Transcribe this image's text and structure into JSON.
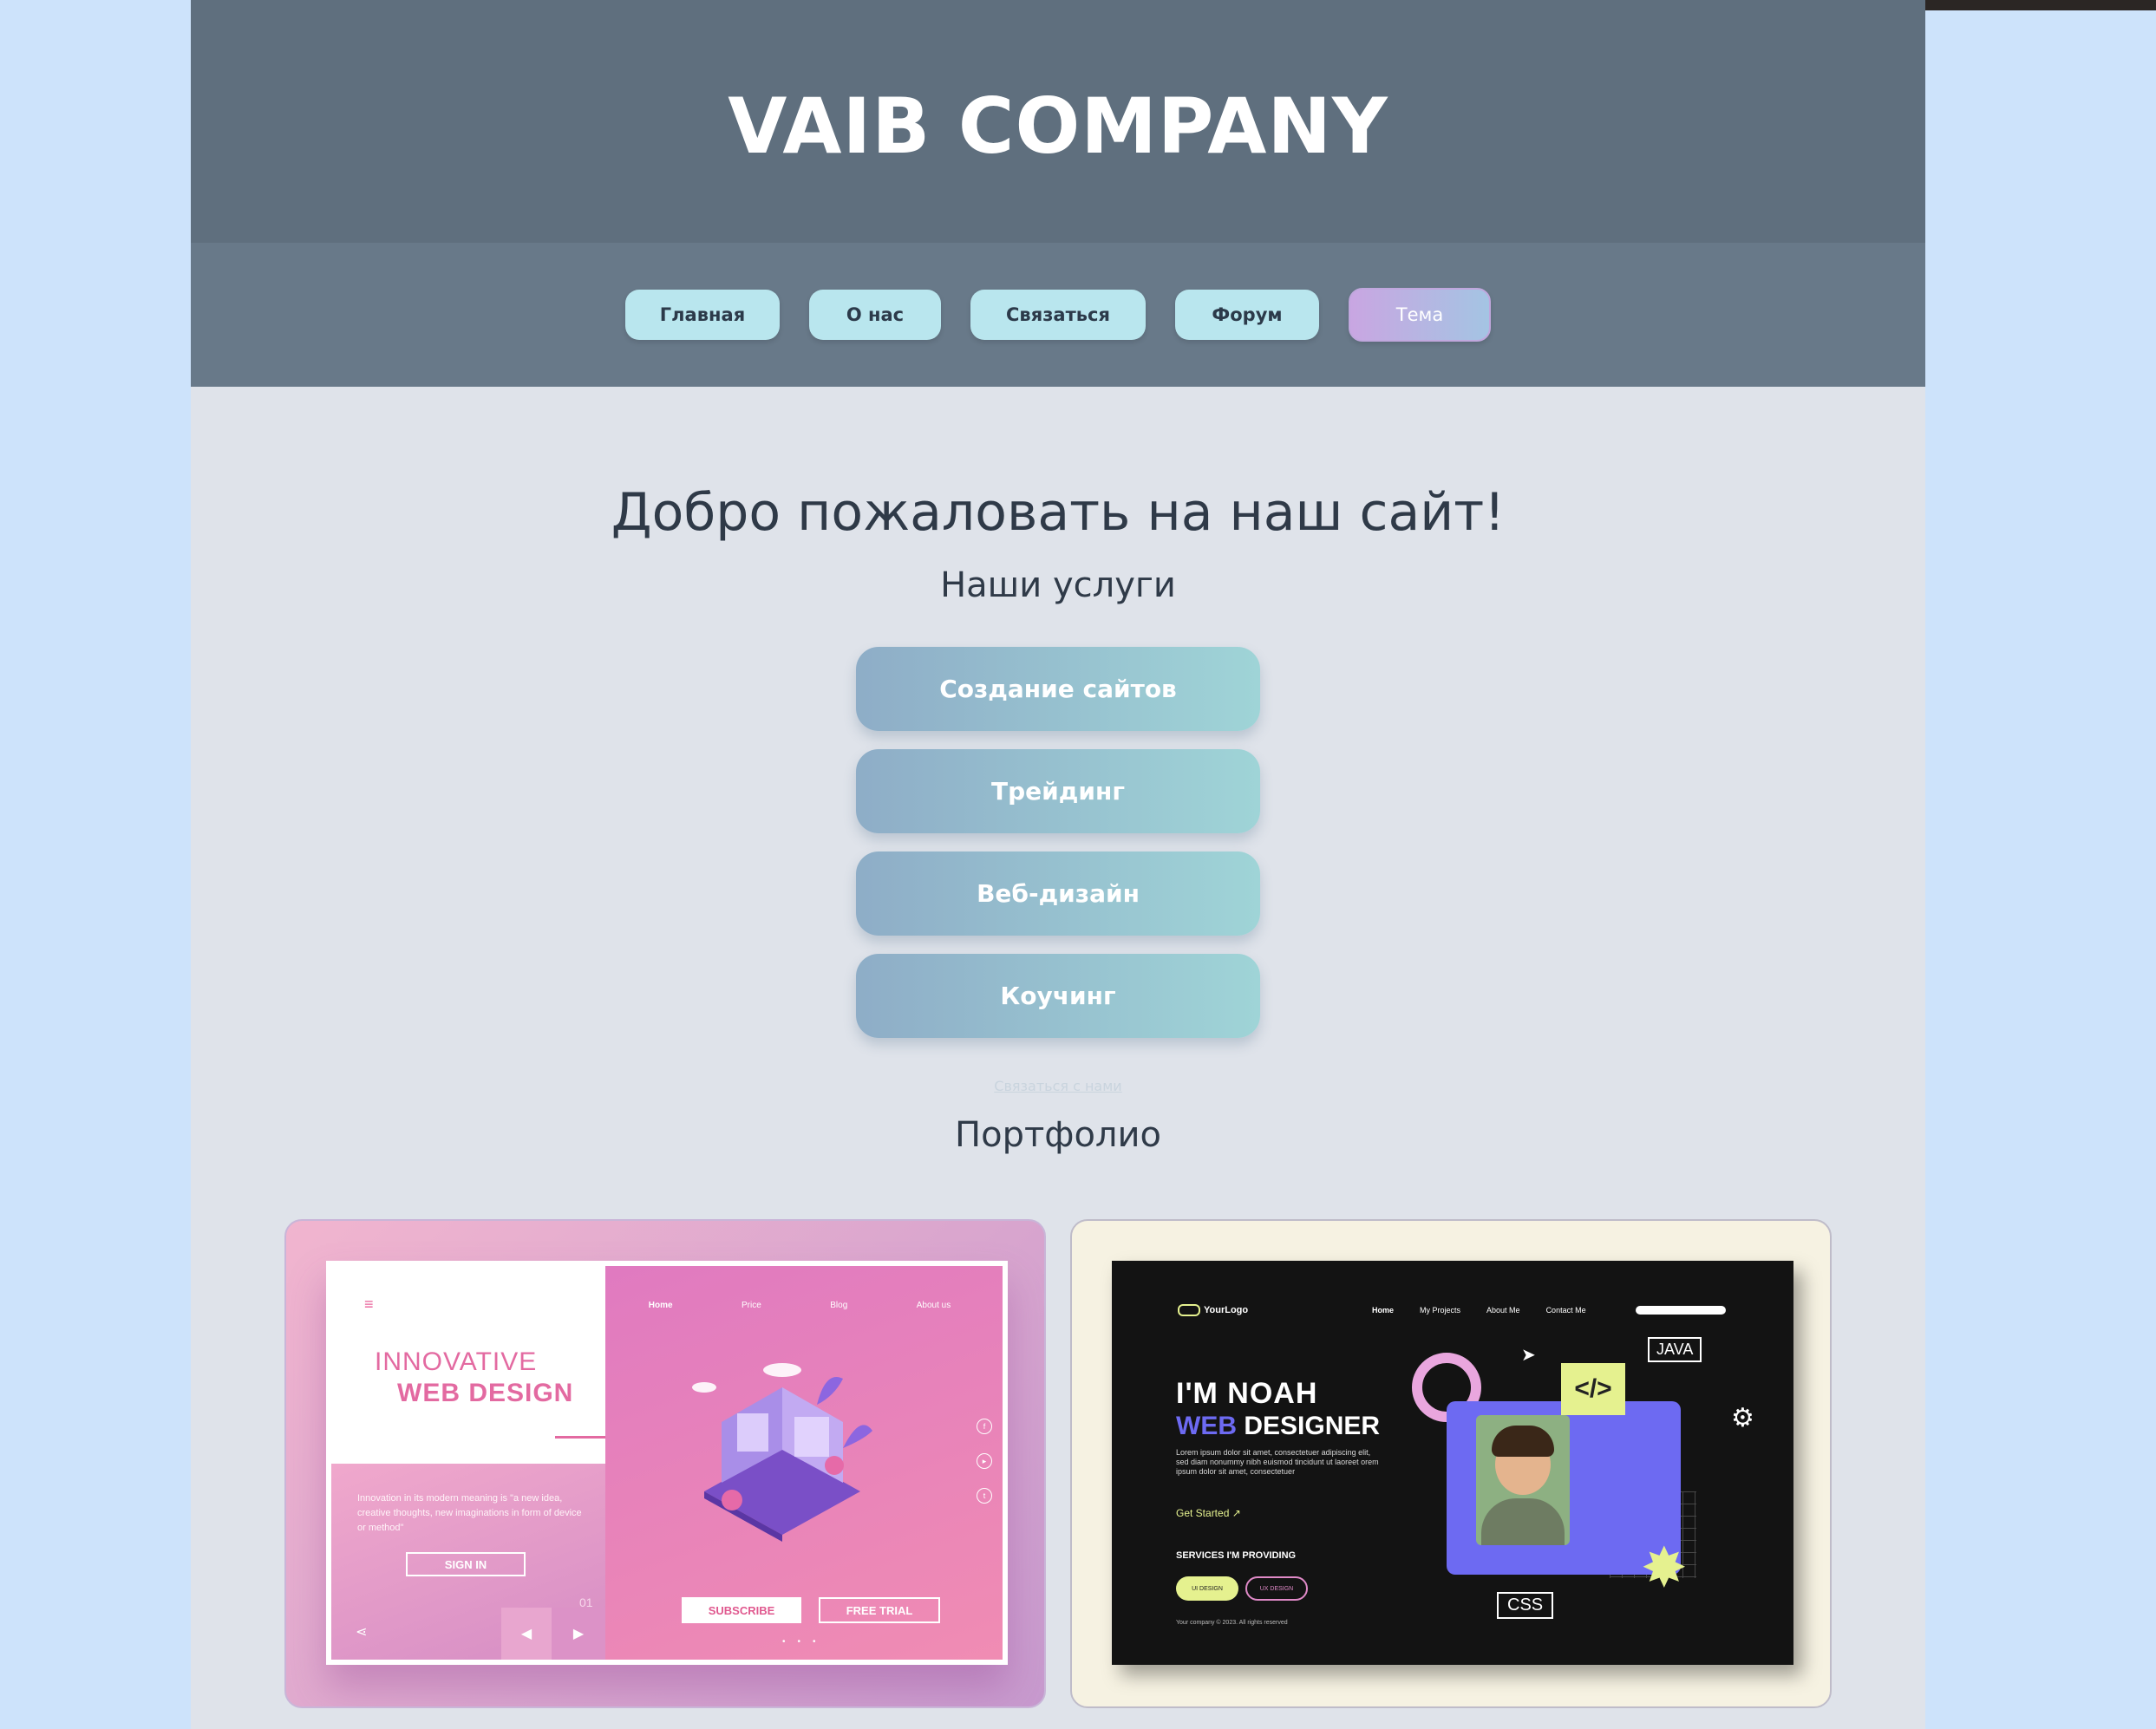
{
  "header": {
    "title": "VAIB COMPANY"
  },
  "nav": {
    "items": [
      {
        "label": "Главная"
      },
      {
        "label": "О нас"
      },
      {
        "label": "Связаться"
      },
      {
        "label": "Форум"
      },
      {
        "label": "Тема"
      }
    ]
  },
  "main": {
    "welcome": "Добро пожаловать на наш сайт!",
    "services_heading": "Наши услуги",
    "services": [
      {
        "label": "Создание сайтов"
      },
      {
        "label": "Трейдинг"
      },
      {
        "label": "Веб-дизайн"
      },
      {
        "label": "Коучинг"
      }
    ],
    "contact_link": "Связаться с нами",
    "portfolio_heading": "Портфолио"
  },
  "portfolio": {
    "card1": {
      "title_line1": "INNOVATIVE",
      "title_line2": "WEB DESIGN",
      "menu_icon": "≡",
      "description": "Innovation in its modern meaning is \"a new idea, creative thoughts, new imaginations in form of device or method\"",
      "signin": "SIGN IN",
      "slide_number": "01",
      "nav": [
        "Home",
        "Price",
        "Blog",
        "About us"
      ],
      "subscribe": "SUBSCRIBE",
      "free_trial": "FREE TRIAL",
      "prev_icon": "◀",
      "next_icon": "▶",
      "share_icon": "⋖"
    },
    "card2": {
      "logo": "YourLogo",
      "nav": [
        "Home",
        "My Projects",
        "About Me",
        "Contact Me"
      ],
      "headline1": "I'M NOAH",
      "headline2_accent": "WEB",
      "headline2_rest": " DESIGNER",
      "lorem": "Lorem ipsum dolor sit amet, consectetuer adipiscing elit, sed diam nonummy nibh euismod tincidunt ut laoreet orem ipsum dolor sit amet, consectetuer",
      "get_started": "Get Started ↗",
      "services_label": "SERVICES I'M PROVIDING",
      "tag1": "UI DESIGN",
      "tag2": "UX DESIGN",
      "footer": "Your company © 2023. All rights reserved",
      "java": "JAVA",
      "css": "CSS",
      "code": "</>"
    }
  },
  "colors": {
    "page_bg": "#cde3fb",
    "header_bg": "#5f6f7e",
    "nav_bg": "#687989",
    "content_bg": "#dfe3ea",
    "nav_button": "#b9e6ee",
    "service_gradient_start": "#8eadc7",
    "service_gradient_end": "#9fd4d7"
  }
}
